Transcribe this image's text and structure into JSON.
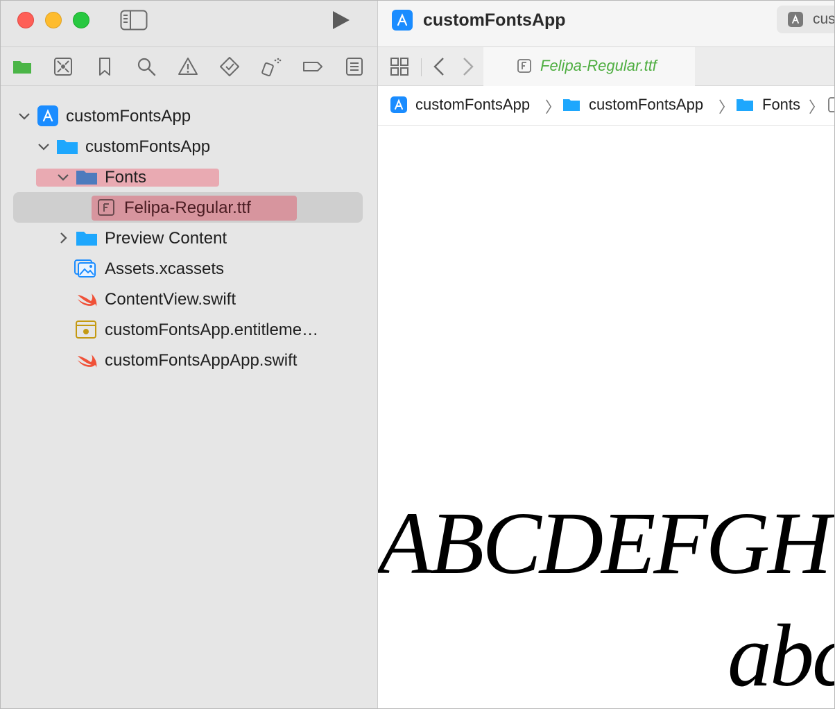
{
  "window": {
    "project_title": "customFontsApp",
    "scheme_label": "customFontsApp"
  },
  "navigator": {
    "tabs": [
      "project-navigator",
      "source-control-navigator",
      "bookmark-navigator",
      "find-navigator",
      "issue-navigator",
      "test-navigator",
      "debug-navigator",
      "breakpoint-navigator",
      "report-navigator"
    ],
    "tree": [
      {
        "label": "customFontsApp",
        "icon": "app-project-icon",
        "expanded": true
      },
      {
        "label": "customFontsApp",
        "icon": "folder-icon",
        "expanded": true
      },
      {
        "label": "Fonts",
        "icon": "folder-icon",
        "expanded": true
      },
      {
        "label": "Felipa-Regular.ttf",
        "icon": "font-file-icon",
        "selected": true
      },
      {
        "label": "Preview Content",
        "icon": "folder-icon",
        "expanded": false
      },
      {
        "label": "Assets.xcassets",
        "icon": "asset-catalog-icon"
      },
      {
        "label": "ContentView.swift",
        "icon": "swift-icon"
      },
      {
        "label": "customFontsApp.entitleme…",
        "icon": "entitlements-icon"
      },
      {
        "label": "customFontsAppApp.swift",
        "icon": "swift-icon"
      }
    ]
  },
  "editor": {
    "tab_label": "Felipa-Regular.ttf",
    "breadcrumbs": [
      "customFontsApp",
      "customFontsApp",
      "Fonts"
    ],
    "font_sample_upper": "ABCDEFGH",
    "font_sample_lower": "abcd"
  },
  "colors": {
    "accent_blue": "#1a8cff",
    "folder_blue": "#1ea7fd",
    "swift_orange": "#f05138",
    "tab_green": "#4fae41",
    "highlight_pink": "#eb7887"
  }
}
